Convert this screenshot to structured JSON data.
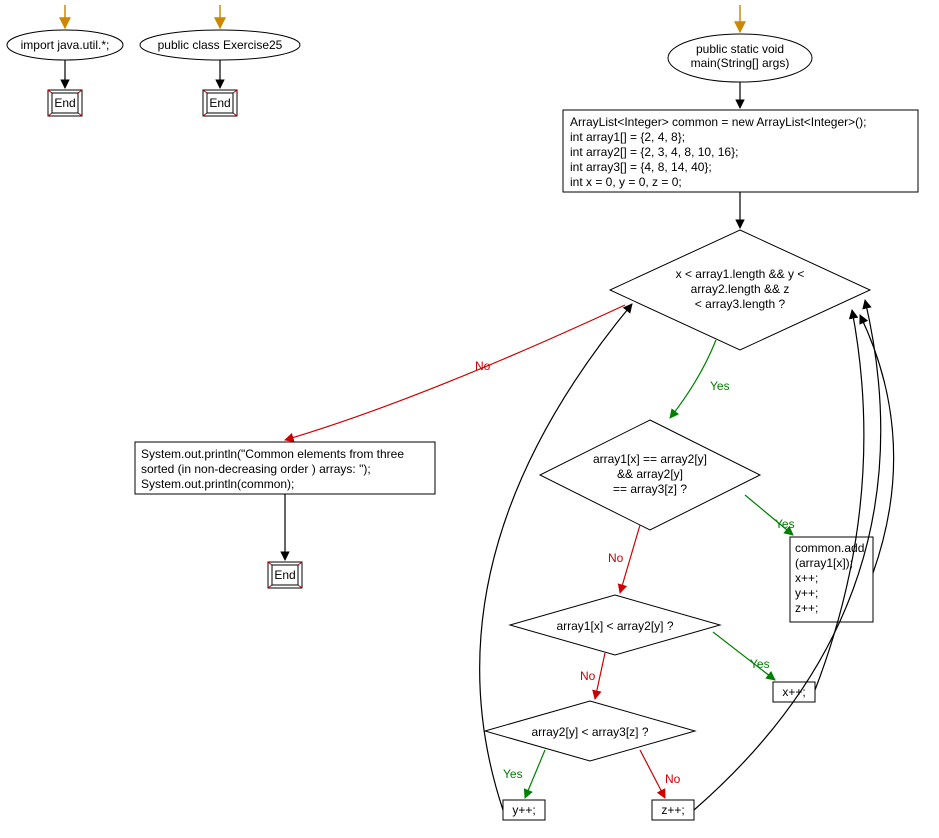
{
  "flow1": {
    "ellipse": "import java.util.*;",
    "end": "End"
  },
  "flow2": {
    "ellipse": "public class Exercise25",
    "end": "End"
  },
  "main": {
    "method": {
      "line1": "public static void",
      "line2": "main(String[] args)"
    },
    "init": {
      "l1": "ArrayList<Integer> common = new ArrayList<Integer>();",
      "l2": "int array1[] = {2, 4, 8};",
      "l3": "int array2[] = {2, 3, 4, 8, 10, 16};",
      "l4": "int array3[] = {4, 8, 14, 40};",
      "l5": "int x = 0, y = 0, z = 0;"
    },
    "cond1": {
      "l1": "x < array1.length && y <",
      "l2": "array2.length && z",
      "l3": "< array3.length ?"
    },
    "cond2": {
      "l1": "array1[x] == array2[y]",
      "l2": "&& array2[y]",
      "l3": "== array3[z] ?"
    },
    "cond3": "array1[x] < array2[y] ?",
    "cond4": "array2[y] < array3[z] ?",
    "commonAdd": {
      "l1": "common.add",
      "l2": "(array1[x]);",
      "l3": "x++;",
      "l4": "y++;",
      "l5": "z++;"
    },
    "xpp": "x++;",
    "ypp": "y++;",
    "zpp": "z++;",
    "print": {
      "l1": "System.out.println(\"Common elements from three",
      "l2": "sorted (in non-decreasing order ) arrays: \");",
      "l3": "System.out.println(common);"
    },
    "end": "End"
  },
  "labels": {
    "yes": "Yes",
    "no": "No"
  },
  "colors": {
    "yesEdge": "#008000",
    "noEdge": "#cc0000",
    "black": "#000000",
    "entryArrow": "#cc8800"
  }
}
